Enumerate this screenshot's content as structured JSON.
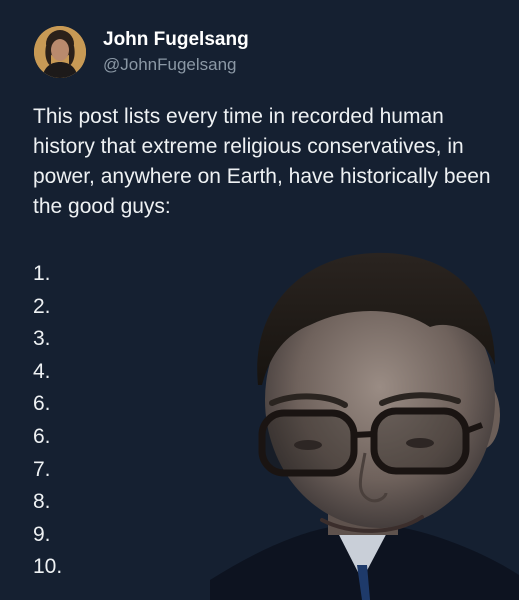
{
  "post": {
    "author": {
      "display_name": "John Fugelsang",
      "handle": "@JohnFugelsang"
    },
    "text": "This post lists every time in recorded human history that extreme religious conservatives, in power, anywhere on Earth, have historically been the good guys:",
    "list_items": [
      "1.",
      "2.",
      "3.",
      "4.",
      "6.",
      "6.",
      "7.",
      "8.",
      "9.",
      "10."
    ]
  },
  "colors": {
    "background": "#152031",
    "text": "#eef1f3",
    "handle": "#8b98a5"
  }
}
